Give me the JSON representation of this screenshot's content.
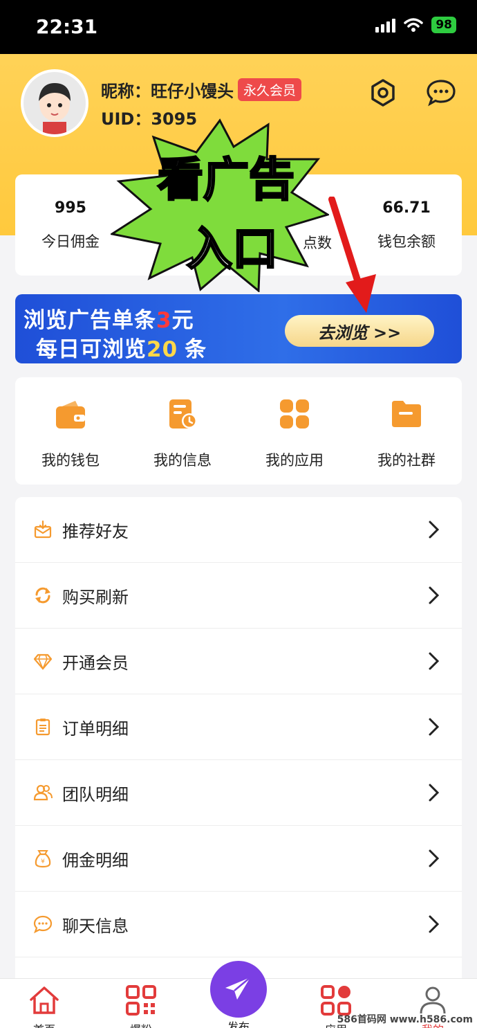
{
  "status_bar": {
    "time": "22:31",
    "battery": "98"
  },
  "profile": {
    "nickname_label": "昵称：",
    "nickname": "旺仔小馒头",
    "badge": "永久会员",
    "uid_label": "UID：",
    "uid": "3095"
  },
  "stats": [
    {
      "value": "995",
      "label": "今日佣金"
    },
    {
      "value": "",
      "label": ""
    },
    {
      "value": "",
      "label": "点数"
    },
    {
      "value": "66.71",
      "label": "钱包余额"
    }
  ],
  "overlay": {
    "line1": "看广告",
    "line2": "入口"
  },
  "banner": {
    "line1_pre": "浏览广告单条",
    "line1_num": "3",
    "line1_post": "元",
    "line2_pre": "每日可浏览",
    "line2_num": "20",
    "line2_post": "条",
    "button": "去浏览 >>"
  },
  "grid": [
    {
      "label": "我的钱包",
      "icon": "wallet-icon"
    },
    {
      "label": "我的信息",
      "icon": "info-doc-icon"
    },
    {
      "label": "我的应用",
      "icon": "apps-icon"
    },
    {
      "label": "我的社群",
      "icon": "folder-icon"
    }
  ],
  "menu": [
    {
      "label": "推荐好友",
      "icon": "invite-icon"
    },
    {
      "label": "购买刷新",
      "icon": "refresh-icon"
    },
    {
      "label": "开通会员",
      "icon": "diamond-icon"
    },
    {
      "label": "订单明细",
      "icon": "order-icon"
    },
    {
      "label": "团队明细",
      "icon": "team-icon"
    },
    {
      "label": "佣金明细",
      "icon": "commission-icon"
    },
    {
      "label": "聊天信息",
      "icon": "chat-icon"
    }
  ],
  "tabs": [
    {
      "label": "首页",
      "icon": "home-icon"
    },
    {
      "label": "爆粉",
      "icon": "qrcode-icon"
    },
    {
      "label": "发布",
      "icon": "send-icon"
    },
    {
      "label": "应用",
      "icon": "apps-tab-icon"
    },
    {
      "label": "我的",
      "icon": "user-icon"
    }
  ],
  "watermark": "586首码网 www.h586.com",
  "colors": {
    "header": "#ffc93d",
    "accent_orange": "#f8a23a",
    "tab_red": "#e23b3b",
    "publish_purple": "#7b3fe4",
    "banner_blue": "#2456dc"
  }
}
